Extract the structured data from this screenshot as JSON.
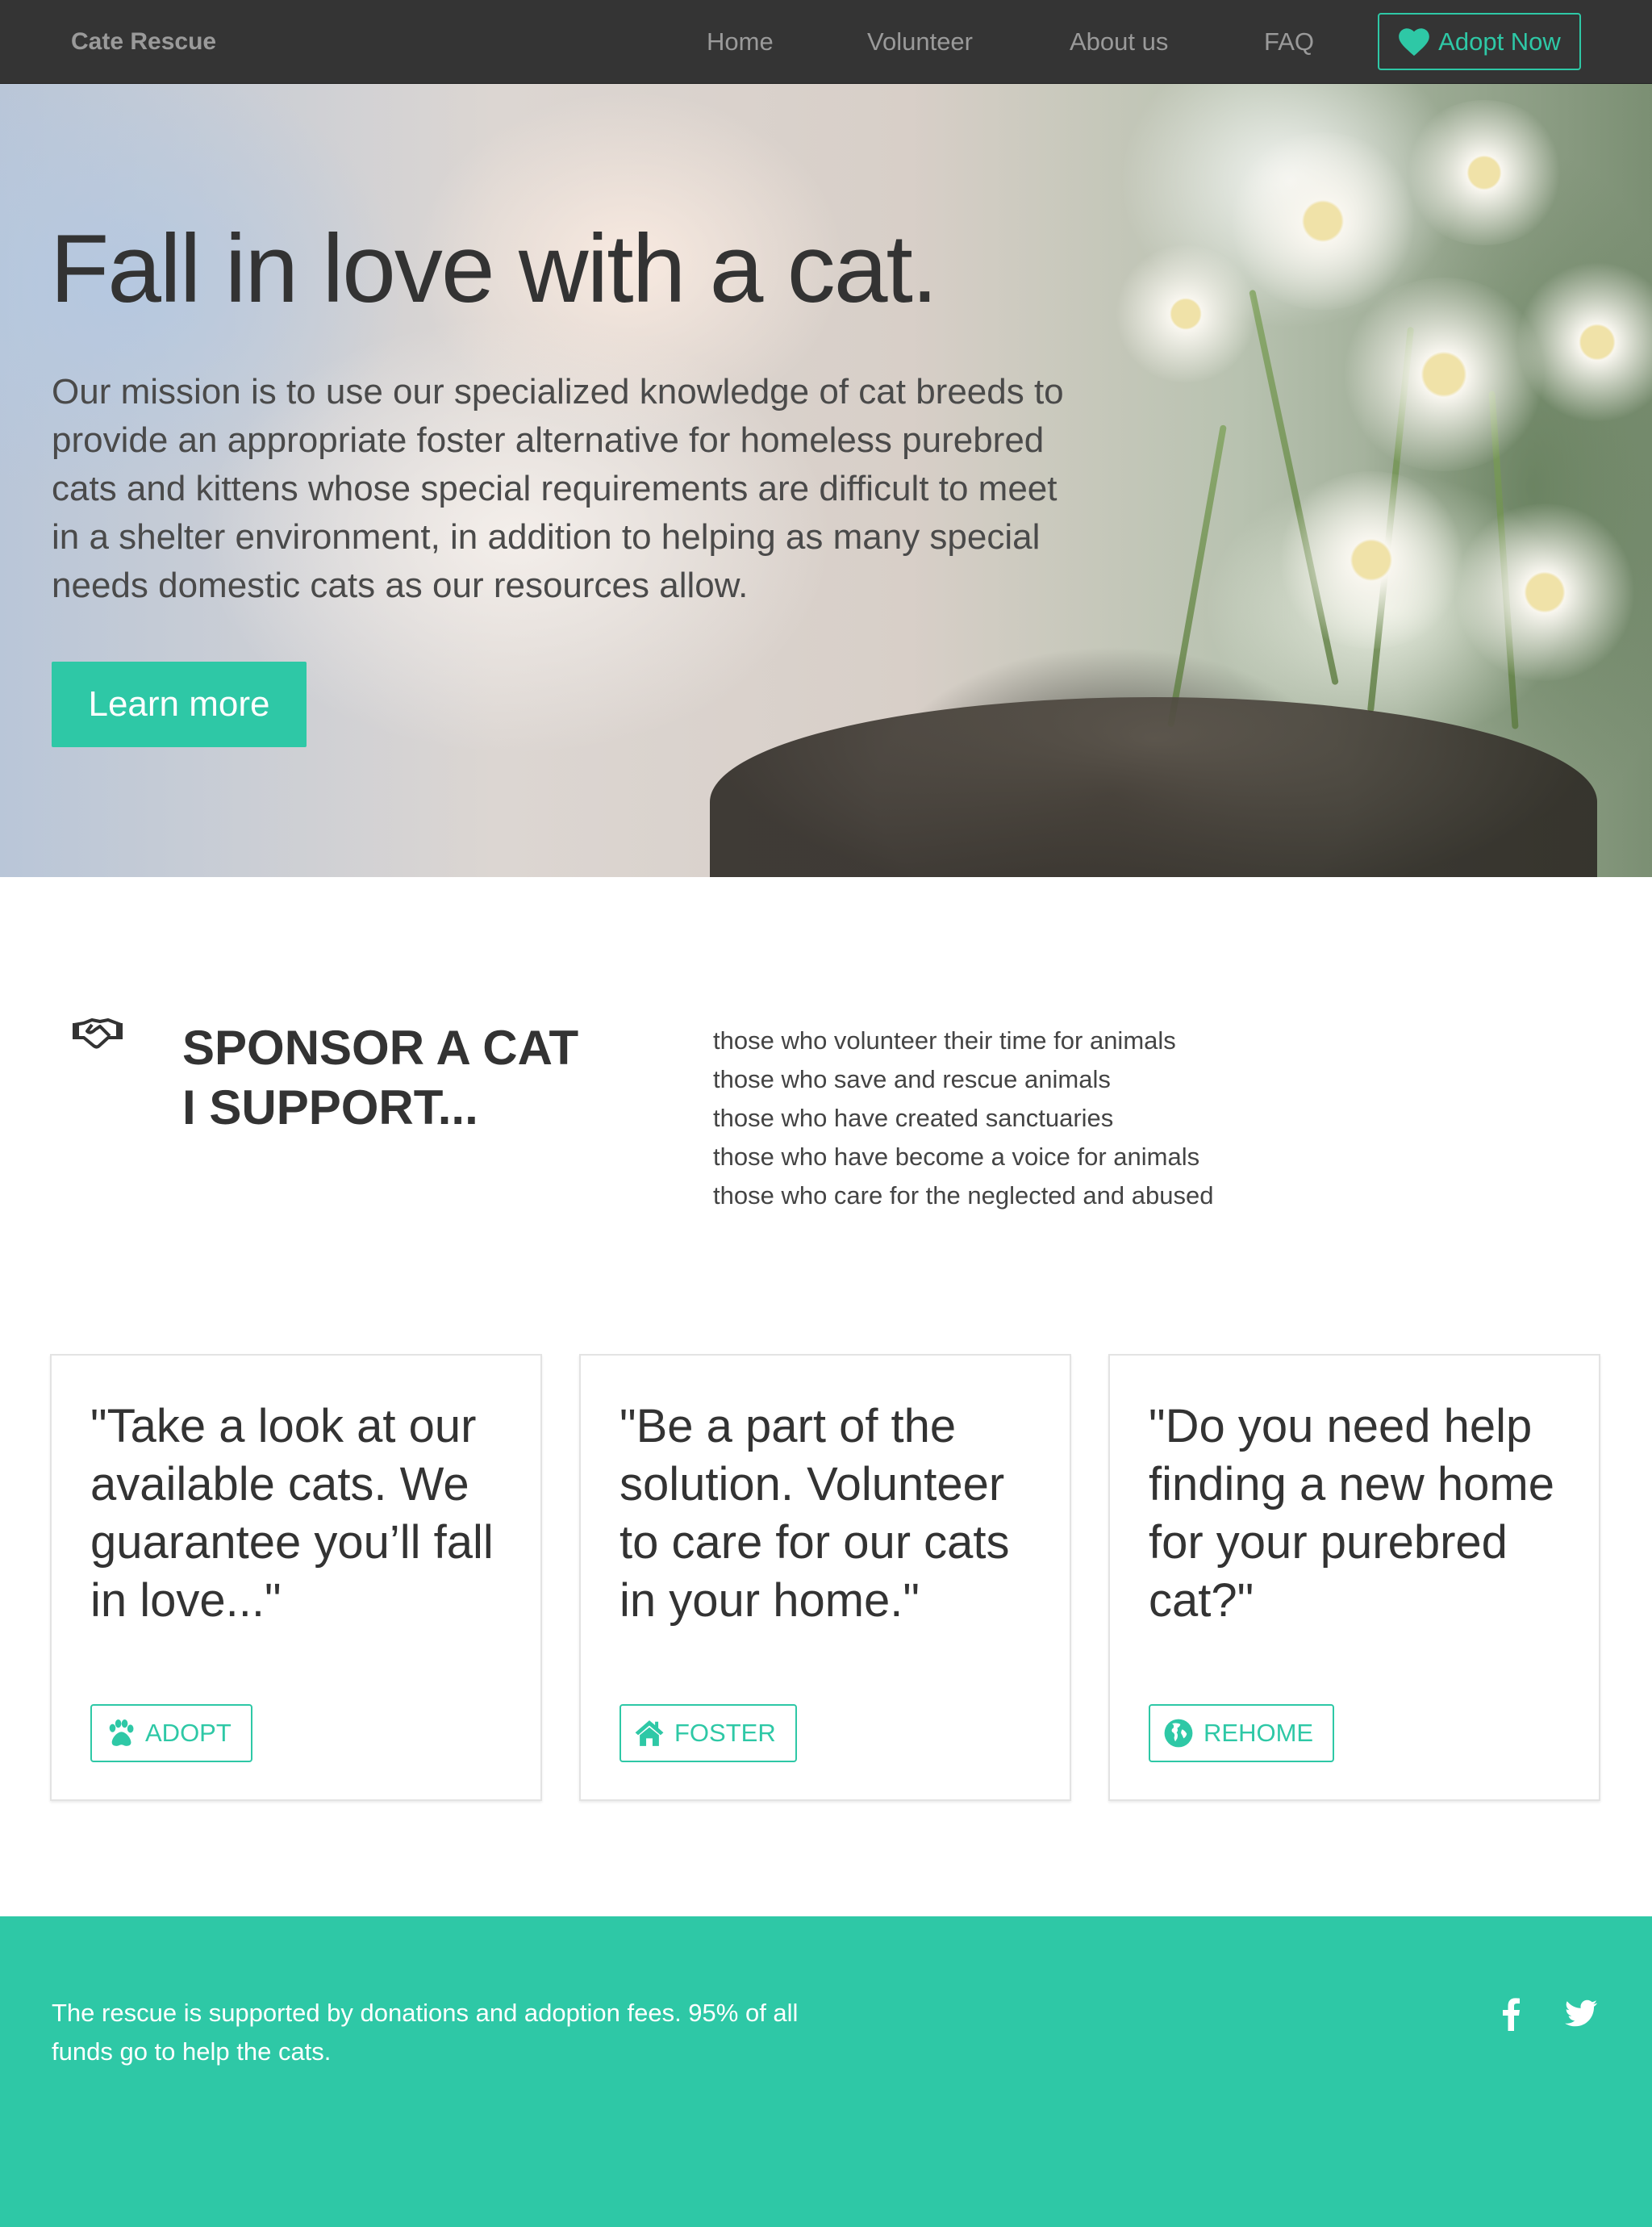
{
  "navbar": {
    "brand": "Cate Rescue",
    "links": [
      "Home",
      "Volunteer",
      "About us",
      "FAQ"
    ],
    "cta_label": "Adopt Now",
    "cta_icon": "heart-icon"
  },
  "hero": {
    "title": "Fall in love with a cat.",
    "text": "Our mission is to use our specialized knowledge of cat breeds to provide an appropriate foster alternative for homeless purebred cats and kittens whose special requirements are difficult to meet in a shelter environment, in addition to helping as many special needs domestic cats as our resources allow.",
    "button_label": "Learn more"
  },
  "sponsor": {
    "icon": "handshake-icon",
    "title_line1": "SPONSOR A CAT",
    "title_line2": "I SUPPORT...",
    "items": [
      "those who volunteer their time for animals",
      "those who save and rescue animals",
      "those who have created sanctuaries",
      "those who have become a voice for animals",
      "those who care for the neglected and abused"
    ]
  },
  "cards": [
    {
      "quote": "\"Take a look at our available cats. We guarantee you’ll fall in love...\"",
      "button": "ADOPT",
      "icon": "paw-icon"
    },
    {
      "quote": "\"Be a part of the solution. Volunteer to care for our cats in your home.\"",
      "button": "FOSTER",
      "icon": "home-icon"
    },
    {
      "quote": "\"Do you need help finding a new home for your purebred cat?\"",
      "button": "REHOME",
      "icon": "globe-icon"
    }
  ],
  "footer": {
    "text": "The rescue is supported by donations and adoption fees. 95% of all funds go to help the cats.",
    "social": [
      "facebook-icon",
      "twitter-icon"
    ]
  },
  "colors": {
    "accent": "#2ec8a6",
    "navbar_bg": "#343434",
    "nav_text": "#9a9a9a",
    "text_dark": "#333333"
  }
}
